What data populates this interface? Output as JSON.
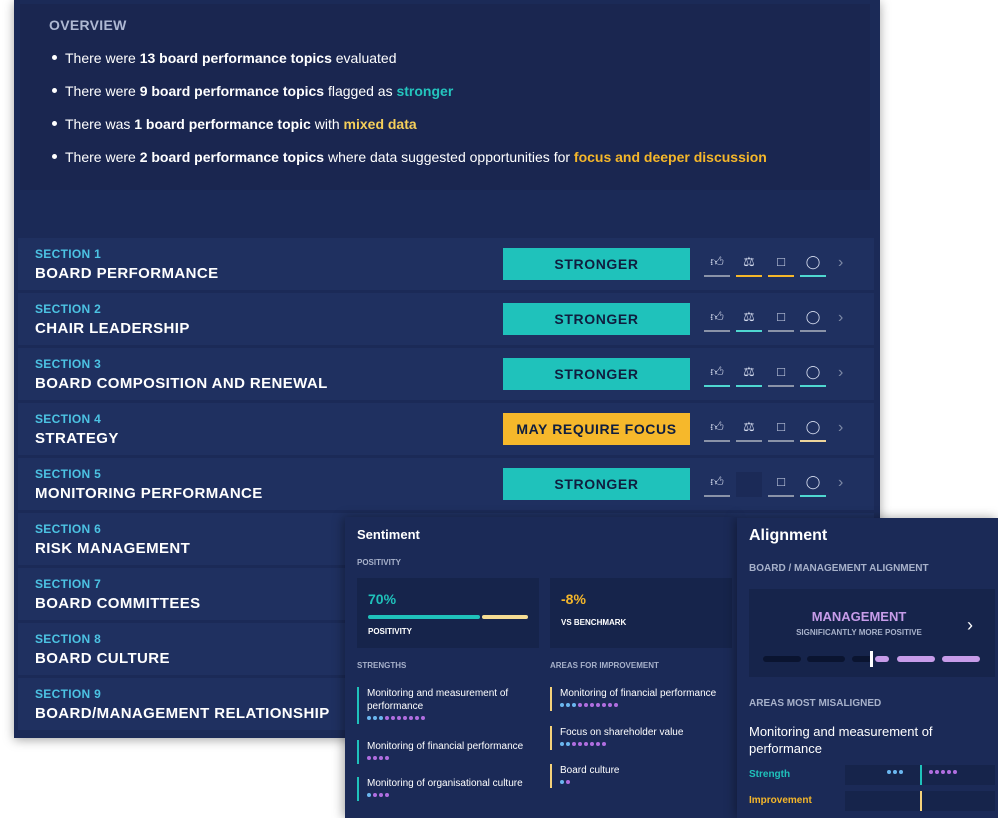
{
  "overview": {
    "title": "OVERVIEW",
    "line1": {
      "pre": "There were ",
      "bold": "13 board performance topics",
      "post": " evaluated"
    },
    "line2": {
      "pre": "There were ",
      "bold": "9 board performance topics",
      "mid": " flagged as ",
      "hl": "stronger"
    },
    "line3": {
      "pre": "There was ",
      "bold": "1 board performance topic",
      "mid": " with ",
      "hl": "mixed data"
    },
    "line4": {
      "pre": "There were ",
      "bold": "2 board performance topics",
      "mid": " where data suggested opportunities for ",
      "hl": "focus and deeper discussion"
    }
  },
  "sections": [
    {
      "num": "SECTION 1",
      "name": "BOARD PERFORMANCE",
      "status": "STRONGER"
    },
    {
      "num": "SECTION 2",
      "name": "CHAIR LEADERSHIP",
      "status": "STRONGER"
    },
    {
      "num": "SECTION 3",
      "name": "BOARD COMPOSITION AND RENEWAL",
      "status": "STRONGER"
    },
    {
      "num": "SECTION 4",
      "name": "STRATEGY",
      "status": "MAY REQUIRE FOCUS"
    },
    {
      "num": "SECTION 5",
      "name": "MONITORING PERFORMANCE",
      "status": "STRONGER"
    },
    {
      "num": "SECTION 6",
      "name": "RISK MANAGEMENT"
    },
    {
      "num": "SECTION 7",
      "name": "BOARD COMMITTEES"
    },
    {
      "num": "SECTION 8",
      "name": "BOARD CULTURE"
    },
    {
      "num": "SECTION 9",
      "name": "BOARD/MANAGEMENT RELATIONSHIP"
    }
  ],
  "icons": [
    "thumbs-up-icon",
    "scales-icon",
    "speech-alert-icon",
    "trophy-icon",
    "chevron-right-icon"
  ],
  "colors": {
    "stronger": "#1fc2bb",
    "focus": "#f6b82b",
    "section_label": "#4cc3e3",
    "management": "#c79ce9"
  },
  "sentiment": {
    "title": "Sentiment",
    "positivity_label": "POSITIVITY",
    "positivity_value": "70%",
    "positivity_fraction": 0.7,
    "positivity_caption": "POSITIVITY",
    "benchmark_value": "-8%",
    "benchmark_caption": "VS BENCHMARK",
    "strengths_label": "STRENGTHS",
    "improvement_label": "AREAS FOR IMPROVEMENT",
    "strengths": [
      {
        "text": "Monitoring and measurement of performance"
      },
      {
        "text": "Monitoring of financial performance"
      },
      {
        "text": "Monitoring of organisational culture"
      }
    ],
    "improvements": [
      {
        "text": "Monitoring of financial performance"
      },
      {
        "text": "Focus on shareholder value"
      },
      {
        "text": "Board culture"
      }
    ]
  },
  "alignment": {
    "title": "Alignment",
    "subtitle": "BOARD / MANAGEMENT ALIGNMENT",
    "group": "MANAGEMENT",
    "group_note": "SIGNIFICANTLY MORE POSITIVE",
    "misaligned_label": "AREAS MOST MISALIGNED",
    "topic": "Monitoring and measurement of performance",
    "strength_label": "Strength",
    "improvement_label": "Improvement"
  }
}
